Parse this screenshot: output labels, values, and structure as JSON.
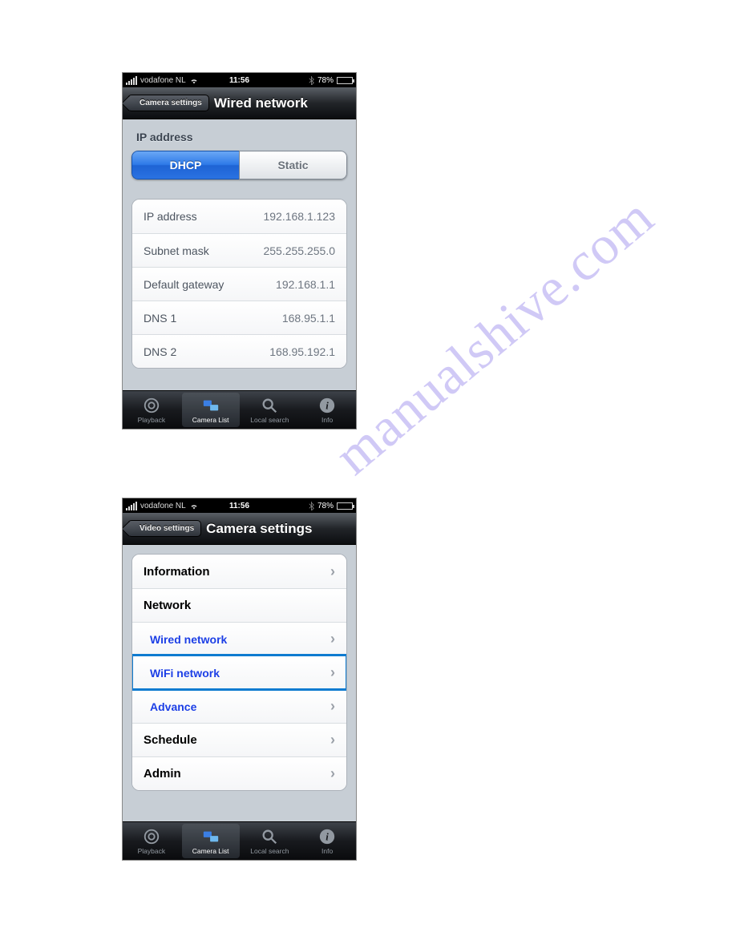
{
  "watermark": "manualshive.com",
  "statusbar": {
    "carrier": "vodafone NL",
    "time": "11:56",
    "battery": "78%"
  },
  "screen1": {
    "back": "Camera settings",
    "title": "Wired network",
    "section": "IP address",
    "seg_active": "DHCP",
    "seg_inactive": "Static",
    "rows": [
      {
        "label": "IP address",
        "value": "192.168.1.123"
      },
      {
        "label": "Subnet mask",
        "value": "255.255.255.0"
      },
      {
        "label": "Default gateway",
        "value": "192.168.1.1"
      },
      {
        "label": "DNS 1",
        "value": "168.95.1.1"
      },
      {
        "label": "DNS 2",
        "value": "168.95.192.1"
      }
    ]
  },
  "screen2": {
    "back": "Video settings",
    "title": "Camera settings",
    "rows": {
      "information": "Information",
      "network": "Network",
      "wired": "Wired network",
      "wifi": "WiFi network",
      "advance": "Advance",
      "schedule": "Schedule",
      "admin": "Admin"
    }
  },
  "tabs": {
    "playback": "Playback",
    "camera_list": "Camera List",
    "local_search": "Local search",
    "info": "Info"
  }
}
